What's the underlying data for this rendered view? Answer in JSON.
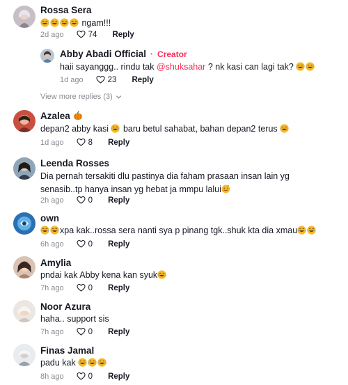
{
  "comments": [
    {
      "name": "Rossa Sera",
      "text_suffix": " ngam!!!",
      "time": "2d ago",
      "likes": "74",
      "reply": "Reply",
      "laugh_count": 4
    },
    {
      "name": "Abby Abadi Official",
      "creator_sep": "·",
      "creator": "Creator",
      "text_before": "haii sayanggg.. rindu tak ",
      "mention": "@shuksahar",
      "text_after": " ? nk kasi can lagi tak? ",
      "time": "1d ago",
      "likes": "23",
      "reply": "Reply"
    },
    {
      "name": "Azalea",
      "name_icon": "pumpkin-icon",
      "text_before": "depan2 abby kasi ",
      "text_after": " baru betul sahabat, bahan depan2 terus ",
      "time": "1d ago",
      "likes": "8",
      "reply": "Reply"
    },
    {
      "name": "Leenda Rosses",
      "text": "Dia pernah tersakiti dlu pastinya dia faham prasaan insan lain yg senasib..tp hanya insan yg hebat ja mmpu lalui",
      "time": "2h ago",
      "likes": "0",
      "reply": "Reply"
    },
    {
      "name": "own",
      "text_mid": "xpa kak..rossa sera nanti sya p pinang tgk..shuk kta dia xmau",
      "time": "6h ago",
      "likes": "0",
      "reply": "Reply"
    },
    {
      "name": "Amylia",
      "text": "pndai kak Abby kena kan syuk",
      "time": "7h ago",
      "likes": "0",
      "reply": "Reply"
    },
    {
      "name": "Noor Azura",
      "text": "haha.. support sis",
      "time": "7h ago",
      "likes": "0",
      "reply": "Reply"
    },
    {
      "name": "Finas Jamal",
      "text": "padu kak ",
      "time": "8h ago",
      "likes": "0",
      "reply": "Reply"
    }
  ],
  "view_more": "View more replies (3)",
  "colors": {
    "accent": "#fe2c55",
    "muted": "#8a8b91",
    "text": "#161823"
  }
}
